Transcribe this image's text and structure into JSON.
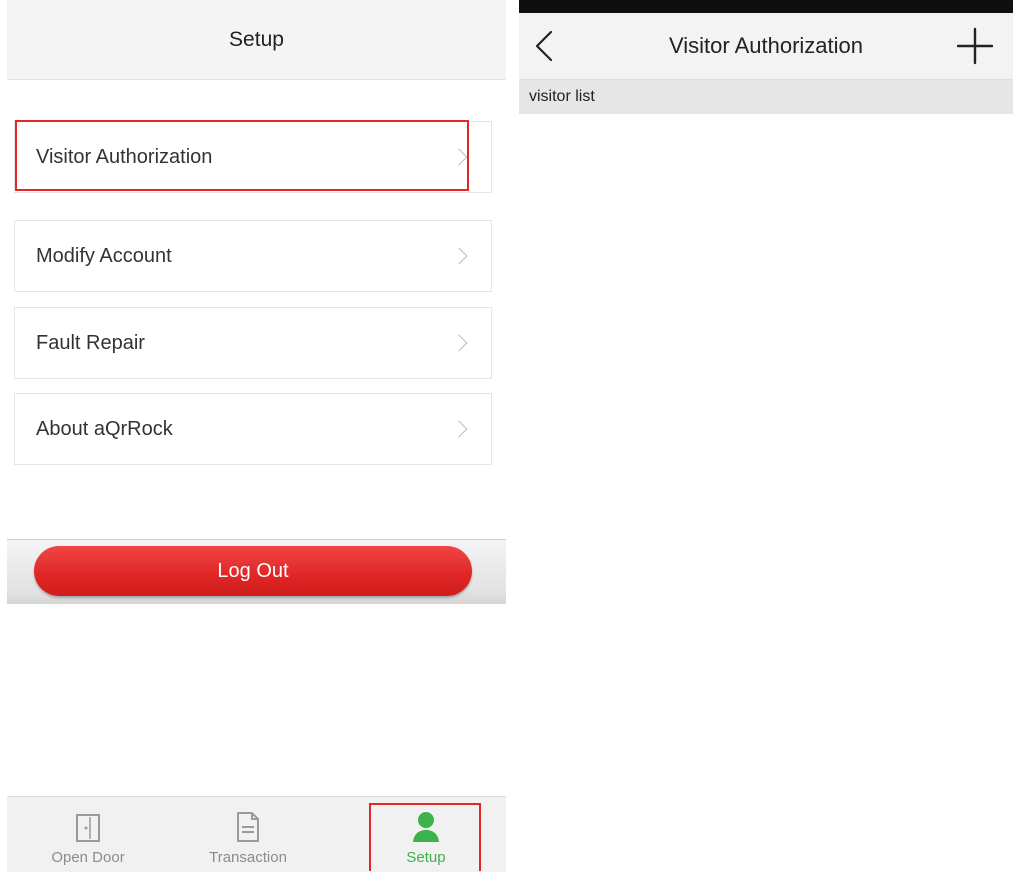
{
  "setup": {
    "header": {
      "title": "Setup"
    },
    "menu": [
      {
        "label": "Visitor Authorization"
      },
      {
        "label": "Modify Account"
      },
      {
        "label": "Fault Repair"
      },
      {
        "label": "About aQrRock"
      }
    ],
    "logout_label": "Log Out",
    "tabs": [
      {
        "label": "Open Door",
        "icon": "door-icon"
      },
      {
        "label": "Transaction",
        "icon": "document-icon"
      },
      {
        "label": "Setup",
        "icon": "person-icon",
        "active": true
      }
    ]
  },
  "visitor": {
    "title": "Visitor Authorization",
    "back_icon": "chevron-left-icon",
    "add_icon": "plus-icon",
    "section_label": "visitor list"
  },
  "colors": {
    "highlight": "#e32626",
    "logout_button": "#e02626",
    "active_tab": "#3bb34a",
    "inactive_tab": "#8c8c8c"
  }
}
